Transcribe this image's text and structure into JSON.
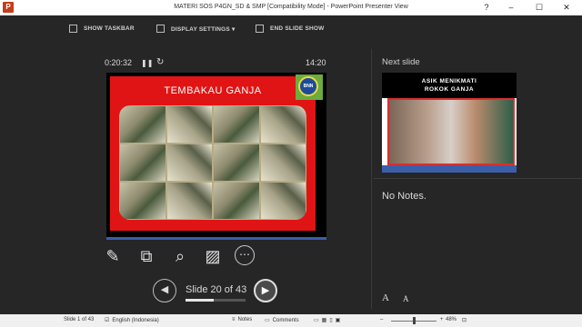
{
  "window": {
    "title": "MATERI SOS P4GN_SD & SMP [Compatibility Mode] - PowerPoint Presenter View",
    "app_icon": "P",
    "buttons": [
      "?",
      "–",
      "☐",
      "✕"
    ]
  },
  "toolbar": {
    "items": [
      {
        "label": "SHOW TASKBAR",
        "icon": "taskbar-icon"
      },
      {
        "label": "DISPLAY SETTINGS ▾",
        "icon": "display-settings-icon"
      },
      {
        "label": "END SLIDE SHOW",
        "icon": "end-show-icon"
      }
    ]
  },
  "timer": {
    "elapsed": "0:20:32",
    "clock": "14:20",
    "pause_icon": "pause-icon",
    "reset_icon": "reset-icon"
  },
  "current_slide": {
    "title": "TEMBAKAU GANJA",
    "logo_text": "BNN",
    "colors": {
      "background": "#e01414",
      "accent": "#3b5ea8",
      "logo_bg": "#6dab3c"
    }
  },
  "tools": [
    {
      "name": "pen-tool-icon",
      "glyph": "✎"
    },
    {
      "name": "see-all-slides-icon",
      "glyph": "⧉"
    },
    {
      "name": "zoom-icon",
      "glyph": "⌕"
    },
    {
      "name": "black-screen-icon",
      "glyph": "▨"
    },
    {
      "name": "more-options-icon",
      "glyph": "⋯"
    }
  ],
  "navigation": {
    "counter": "Slide 20 of 43",
    "progress": 0.465,
    "prev_icon": "◀",
    "next_icon": "▶"
  },
  "next_slide": {
    "label": "Next slide",
    "headline_line1": "ASIK MENIKMATI",
    "headline_line2": "ROKOK GANJA"
  },
  "notes": {
    "text": "No Notes."
  },
  "font_controls": {
    "increase": "A",
    "decrease": "A"
  },
  "statusbar": {
    "slide": "Slide 1 of 43",
    "language": "English (Indonesia)",
    "notes": "Notes",
    "comments": "Comments",
    "zoom": "48%"
  }
}
